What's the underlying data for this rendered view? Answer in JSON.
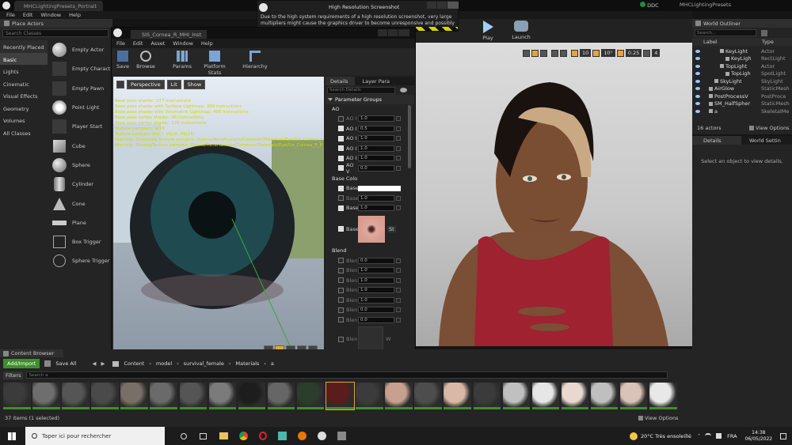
{
  "main_window": {
    "title": "MHCLightingPresets_Portrait",
    "menu": [
      "File",
      "Edit",
      "Window",
      "Help"
    ],
    "project_name": "MHCLightingPresets",
    "ddc_label": "DDC"
  },
  "toolbar": {
    "play": "Play",
    "launch": "Launch"
  },
  "place_actors": {
    "tab": "Place Actors",
    "search_placeholder": "Search Classes",
    "categories": [
      "Recently Placed",
      "Basic",
      "Lights",
      "Cinematic",
      "Visual Effects",
      "Geometry",
      "Volumes",
      "All Classes"
    ],
    "items": [
      "Empty Actor",
      "Empty Charact",
      "Empty Pawn",
      "Point Light",
      "Player Start",
      "Cube",
      "Sphere",
      "Cylinder",
      "Cone",
      "Plane",
      "Box Trigger",
      "Sphere Trigger"
    ]
  },
  "notification": {
    "title": "High Resolution Screenshot",
    "text_line1": "Due to the high system requirements of a high resolution screenshot, very large",
    "text_line2": "multipliers might cause the graphics driver to become unresponsive and possibly crash."
  },
  "material_editor": {
    "tab_title": "SIS_Cornea_R_MHI_Inst",
    "menu": [
      "File",
      "Edit",
      "Asset",
      "Window",
      "Help"
    ],
    "toolbar": [
      "Save",
      "Browse",
      "Params",
      "Platform Stats",
      "Hierarchy"
    ],
    "viewport_buttons": [
      "Perspective",
      "Lit",
      "Show"
    ],
    "stats_lines": [
      "Base pass shader: 277 instructions",
      "Base pass shader with Surface Lightmap: 309 instructions",
      "Base pass shader with Volumetric Lightmap: 400 instructions",
      "Base pass vertex shader: 46 instructions",
      "Base pass vertex shader: 129 instructions",
      "Texture samplers: 9/16",
      "Texture Lookups (Est.): VS(0), PS(15)",
      "Warning: Grayscale texture samples: /Game/MetaHumans/Common/Materials/Eye/Sis_Cornea_R",
      "Warning: MissingTexture samples: /Game/MetaHumans/Common/Materials/Eye/Sis_Cornea_R_PupilMask Sis_Cornea"
    ],
    "details_tab": "Details",
    "layer_tab": "Layer Para",
    "search_placeholder": "Search Details",
    "parameter_groups_label": "Parameter Groups",
    "ao_group": "AO",
    "ao_rows": [
      {
        "label": "AO I",
        "value": "1.0",
        "on": false
      },
      {
        "label": "AO I",
        "value": "0.5",
        "on": true
      },
      {
        "label": "AO I",
        "value": "1.0",
        "on": true
      },
      {
        "label": "AO I",
        "value": "1.0",
        "on": true
      },
      {
        "label": "AO I",
        "value": "1.0",
        "on": true
      },
      {
        "label": "AO V",
        "value": "0.0",
        "on": true
      }
    ],
    "base_color_group": "Base Colo",
    "base_rows": [
      {
        "label": "Base",
        "value": "",
        "on": true
      },
      {
        "label": "Base",
        "value": "1.0",
        "on": false
      },
      {
        "label": "Base",
        "value": "1.0",
        "on": true
      }
    ],
    "base_texture_label": "Base",
    "base_texture_dropdown": "St",
    "blend_group": "Blend",
    "blend_rows": [
      {
        "label": "Blen",
        "value": "0.0"
      },
      {
        "label": "Blen",
        "value": "1.0"
      },
      {
        "label": "Blen",
        "value": "1.0"
      },
      {
        "label": "Blen",
        "value": "1.0"
      },
      {
        "label": "Blen",
        "value": "1.0"
      },
      {
        "label": "Blen",
        "value": "0.0"
      },
      {
        "label": "Blen",
        "value": "0.0"
      }
    ],
    "blend_texture_label": "Blen",
    "blend_texture_dropdown": "W"
  },
  "level_viewport": {
    "snap_values": [
      "10",
      "10°",
      "0.25"
    ],
    "camera_speed": "4"
  },
  "world_outliner": {
    "tab": "World Outliner",
    "search_placeholder": "Search...",
    "col_label": "Label",
    "col_type": "Type",
    "rows": [
      {
        "label": "KeyLight",
        "type": "Actor",
        "indent": 3
      },
      {
        "label": "KeyLigh",
        "type": "RectLight",
        "indent": 4
      },
      {
        "label": "TopLight",
        "type": "Actor",
        "indent": 3
      },
      {
        "label": "TopLigh",
        "type": "SpotLight",
        "indent": 4
      },
      {
        "label": "SkyLight",
        "type": "SkyLight",
        "indent": 2
      },
      {
        "label": "AirGlow",
        "type": "StaticMesh",
        "indent": 1
      },
      {
        "label": "PostProcessV",
        "type": "PostProce",
        "indent": 1
      },
      {
        "label": "SM_HalfSpher",
        "type": "StaticMesh",
        "indent": 1
      },
      {
        "label": "a",
        "type": "SkeletalMe",
        "indent": 1
      }
    ],
    "actor_count": "16 actors",
    "view_options": "View Options"
  },
  "details": {
    "tab": "Details",
    "tab2": "World Settin",
    "empty_text": "Select an object to view details."
  },
  "content_browser": {
    "tab": "Content Browser",
    "add_import": "Add/Import",
    "save_all": "Save All",
    "breadcrumb": [
      "Content",
      "model",
      "survival_female",
      "Materials",
      "a"
    ],
    "filters": "Filters",
    "search_placeholder": "Search a",
    "status": "37 items (1 selected)",
    "view_options": "View Options",
    "thumb_colors": [
      "#3b3b3b",
      "#6e6e6e",
      "#555",
      "#4a4a4a",
      "#7a6f66",
      "#6a6a6a",
      "#555",
      "#7b7b7b",
      "#1d1d1d",
      "#666",
      "#2c3d2c",
      "#5a1c1c",
      "#3b3b3b",
      "#c8a090",
      "#4d4d4d",
      "#d9b8a8",
      "#3b3b3b",
      "#c0c0c0",
      "#e6e6e6",
      "#e8d8d0",
      "#bfbfbf",
      "#d9c2b8",
      "#e8e8e8"
    ]
  },
  "taskbar": {
    "search_placeholder": "Taper ici pour rechercher",
    "weather": "20°C  Très ensoleillé",
    "language": "FRA",
    "time": "14:38",
    "date": "06/05/2022"
  },
  "colors": {
    "ue_bg": "#1a1a1a",
    "panel_bg": "#262626",
    "accent_orange": "#e8a33a",
    "accent_green": "#3d8f2b",
    "selection_blue": "#1a4f8f",
    "warning_yellow": "#d5d500"
  }
}
